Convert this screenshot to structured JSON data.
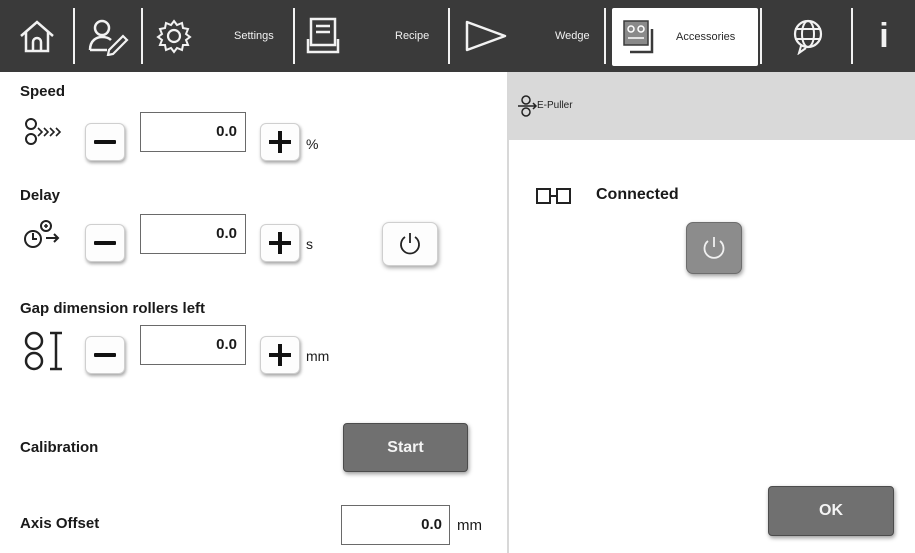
{
  "toolbar": {
    "items": [
      {
        "icon": "home-icon"
      },
      {
        "icon": "user-edit-icon"
      },
      {
        "icon": "gear-icon",
        "label": "Settings"
      },
      {
        "icon": "recipe-icon",
        "label": "Recipe"
      },
      {
        "icon": "wedge-icon",
        "label": "Wedge"
      },
      {
        "icon": "accessories-icon",
        "label": "Accessories"
      },
      {
        "icon": "globe-icon"
      },
      {
        "icon": "info-icon",
        "label": "i"
      }
    ],
    "active": "Accessories",
    "colors": {
      "bar": "#3a3a3a",
      "active_bg": "#ffffff"
    }
  },
  "left": {
    "speed": {
      "title": "Speed",
      "value": "0.0",
      "unit": "%",
      "icon": "speed-icon"
    },
    "delay": {
      "title": "Delay",
      "value": "0.0",
      "unit": "s",
      "icon": "delay-icon"
    },
    "gap": {
      "title": "Gap dimension rollers left",
      "value": "0.0",
      "unit": "mm",
      "icon": "gap-rollers-icon"
    },
    "calibration": {
      "title": "Calibration",
      "button": "Start"
    },
    "axis_offset": {
      "title": "Axis Offset",
      "value": "0.0",
      "unit": "mm"
    }
  },
  "right": {
    "header": {
      "title": "E-Puller",
      "icon": "e-puller-icon"
    },
    "status": {
      "label": "Connected",
      "icon": "connected-icon"
    },
    "ok_button": "OK"
  }
}
